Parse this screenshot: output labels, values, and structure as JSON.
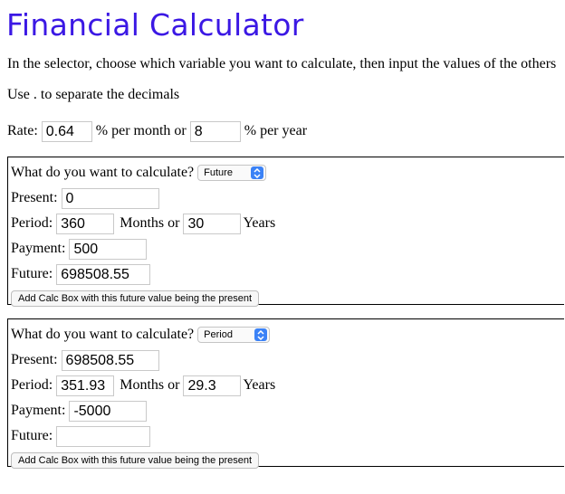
{
  "title": "Financial Calculator",
  "instructions": {
    "line1": "In the selector, choose which variable you want to calculate, then input the values of the others",
    "line2": "Use . to separate the decimals"
  },
  "rate": {
    "label": "Rate:",
    "month_value": "0.64",
    "month_suffix": "% per month or",
    "year_value": "8",
    "year_suffix": "% per year"
  },
  "boxes": [
    {
      "question": "What do you want to calculate?",
      "select_value": "Future",
      "present_label": "Present:",
      "present_value": "0",
      "period_label": "Period:",
      "period_months": "360",
      "months_or": "Months or",
      "period_years": "30",
      "years_label": "Years",
      "payment_label": "Payment:",
      "payment_value": "500",
      "future_label": "Future:",
      "future_value": "698508.55",
      "button_label": "Add Calc Box with this future value being the present"
    },
    {
      "question": "What do you want to calculate?",
      "select_value": "Period",
      "present_label": "Present:",
      "present_value": "698508.55",
      "period_label": "Period:",
      "period_months": "351.93",
      "months_or": "Months or",
      "period_years": "29.3",
      "years_label": "Years",
      "payment_label": "Payment:",
      "payment_value": "-5000",
      "future_label": "Future:",
      "future_value": "",
      "button_label": "Add Calc Box with this future value being the present"
    }
  ],
  "icons": {
    "select_arrow": "chevron-updown-icon"
  },
  "colors": {
    "title": "#3b18e4",
    "select_arrow": "#3b82f6"
  }
}
